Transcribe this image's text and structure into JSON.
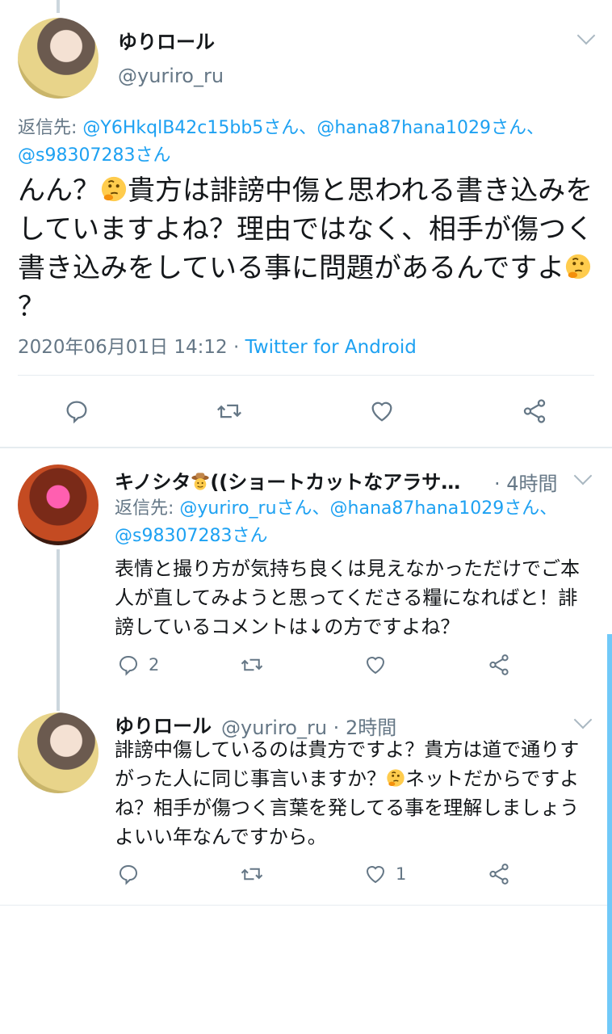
{
  "main_tweet": {
    "name": "ゆりロール",
    "handle": "@yuriro_ru",
    "reply_prefix": "返信先: ",
    "reply_to_1": "@Y6HkqlB42c15bb5さん、",
    "reply_to_2": "@hana87hana1029さん、",
    "reply_to_3": "@s98307283さん",
    "text_1": "んん？",
    "text_2": "貴方は誹謗中傷と思われる書き込みをしていますよね？理由ではなく、相手が傷つく書き込みをしている事に問題があるんですよ",
    "text_3": "？",
    "timestamp": "2020年06月01日 14:12 · ",
    "client": "Twitter for Android"
  },
  "reply_1": {
    "name_1": "キノシタ",
    "name_2": "((ショートカットなアラサ…",
    "time": "· 4時間",
    "reply_prefix": "返信先: ",
    "reply_to_1": "@yuriro_ruさん、",
    "reply_to_2": "@hana87hana1029さん、",
    "reply_to_3": "@s98307283さん",
    "text": "表情と撮り方が気持ち良くは見えなかっただけでご本人が直してみようと思ってくださる糧になればと！誹謗しているコメントは↓の方ですよね？",
    "reply_count": "2"
  },
  "reply_2": {
    "name": "ゆりロール",
    "handle_time": "@yuriro_ru · 2時間",
    "text_1": "誹謗中傷しているのは貴方ですよ？貴方は道で通りすがった人に同じ事言いますか？",
    "text_2": "ネットだからですよね？相手が傷つく言葉を発してる事を理解しましょうよいい年なんですから。",
    "like_count": "1"
  },
  "colors": {
    "accent": "#1da1f2",
    "muted": "#657786",
    "text": "#14171a",
    "divider": "#e6ecf0",
    "scroll": "#71c9f8"
  },
  "icons": [
    "reply-icon",
    "retweet-icon",
    "like-icon",
    "share-icon",
    "chevron-down-icon",
    "thinking-emoji",
    "cowboy-emoji"
  ]
}
